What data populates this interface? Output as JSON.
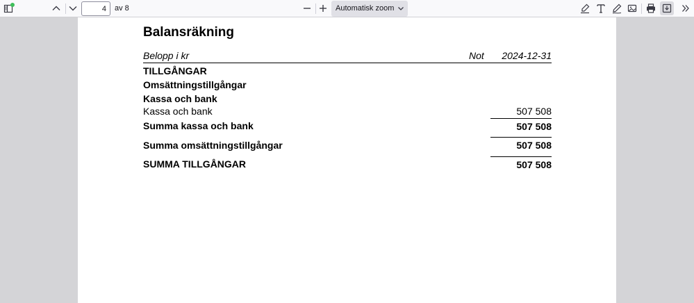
{
  "toolbar": {
    "page_number": "4",
    "page_count": "av 8",
    "zoom": "Automatisk zoom",
    "icons": {
      "sidebar": "sidebar-toggle-icon",
      "previous": "chevron-up-icon",
      "next": "chevron-down-icon",
      "zoom_out": "minus-icon",
      "zoom_in": "plus-icon",
      "highlight": "highlighter-icon",
      "text": "text-icon",
      "draw": "pen-icon",
      "image": "image-icon",
      "print": "printer-icon",
      "save": "save-download-icon",
      "more": "double-chevron-right-icon"
    },
    "badge_color": "#3fbf5a"
  },
  "document": {
    "title": "Balansräkning",
    "header": {
      "col_label": "Belopp i kr",
      "col_note": "Not",
      "col_date": "2024-12-31"
    },
    "rows": [
      {
        "label": "TILLGÅNGAR",
        "value": ""
      },
      {
        "label": "Omsättningstillgångar",
        "value": ""
      },
      {
        "label": "Kassa och bank",
        "value": ""
      },
      {
        "label": "Kassa och bank",
        "value": "507 508"
      },
      {
        "label": "Summa kassa och bank",
        "value": "507 508"
      },
      {
        "label": "Summa omsättningstillgångar",
        "value": "507 508"
      },
      {
        "label": "SUMMA TILLGÅNGAR",
        "value": "507 508"
      }
    ]
  }
}
